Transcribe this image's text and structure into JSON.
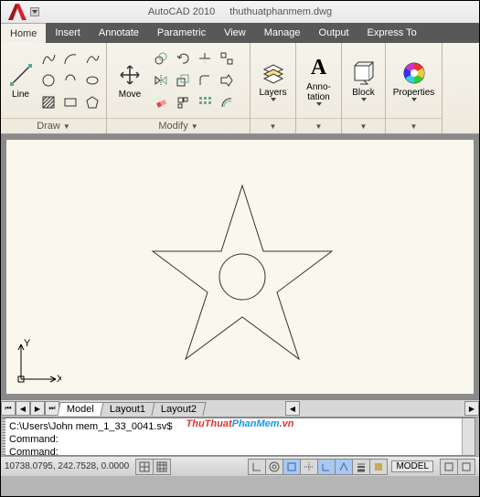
{
  "title": {
    "app": "AutoCAD 2010",
    "file": "thuthuatphanmem.dwg"
  },
  "menu": [
    "Home",
    "Insert",
    "Annotate",
    "Parametric",
    "View",
    "Manage",
    "Output",
    "Express To"
  ],
  "ribbon": {
    "draw": {
      "big": "Line",
      "title": "Draw"
    },
    "modify": {
      "big": "Move",
      "title": "Modify"
    },
    "layers": {
      "label": "Layers"
    },
    "anno": {
      "label": "Anno-\ntation"
    },
    "block": {
      "label": "Block"
    },
    "props": {
      "label": "Properties"
    }
  },
  "tabs": {
    "model": "Model",
    "l1": "Layout1",
    "l2": "Layout2"
  },
  "command": {
    "line1": "C:\\Users\\John                                    mem_1_33_0041.sv$",
    "line2": "Command:",
    "line3": "Command:"
  },
  "status": {
    "coords": "10738.0795, 242.7528, 0.0000",
    "model": "MODEL"
  },
  "watermark": {
    "a": "ThuThuat",
    "b": "PhanMem",
    "c": ".vn"
  },
  "ucs": {
    "x": "X",
    "y": "Y"
  }
}
